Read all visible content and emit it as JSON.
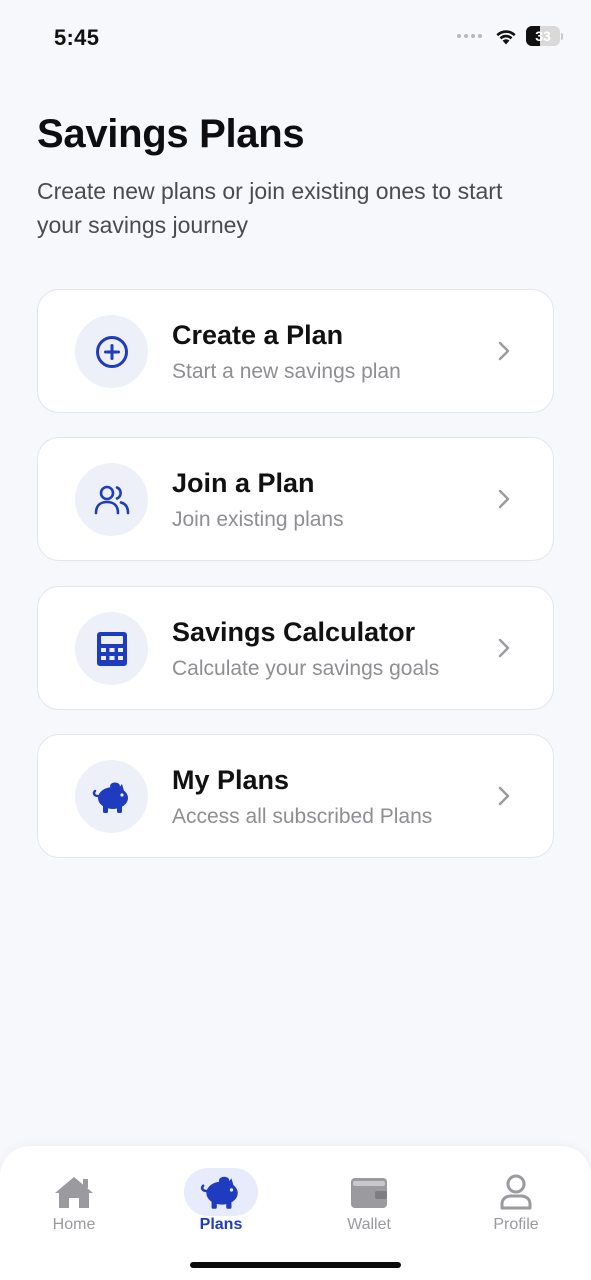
{
  "status_bar": {
    "time": "5:45",
    "battery": "33",
    "icons": [
      "signal-dots-icon",
      "wifi-icon",
      "battery-icon"
    ]
  },
  "header": {
    "title": "Savings Plans",
    "subtitle": "Create new plans or join existing ones to start your savings journey"
  },
  "cards": [
    {
      "title": "Create a Plan",
      "description": "Start a new savings plan",
      "icon": "plus-circle-icon"
    },
    {
      "title": "Join a Plan",
      "description": "Join existing plans",
      "icon": "users-icon"
    },
    {
      "title": "Savings Calculator",
      "description": "Calculate your savings goals",
      "icon": "calculator-icon"
    },
    {
      "title": "My Plans",
      "description": "Access all subscribed Plans",
      "icon": "piggy-bank-icon"
    }
  ],
  "bottom_nav": {
    "items": [
      {
        "label": "Home",
        "icon": "home-icon",
        "active": false
      },
      {
        "label": "Plans",
        "icon": "piggy-bank-icon",
        "active": true
      },
      {
        "label": "Wallet",
        "icon": "wallet-icon",
        "active": false
      },
      {
        "label": "Profile",
        "icon": "user-icon",
        "active": false
      }
    ]
  },
  "colors": {
    "accent": "#1f3bbf",
    "icon_bg": "#eef0f9",
    "background": "#f7f8fb",
    "muted_text": "#8e8e93",
    "inactive_nav": "#9a9a9f"
  }
}
